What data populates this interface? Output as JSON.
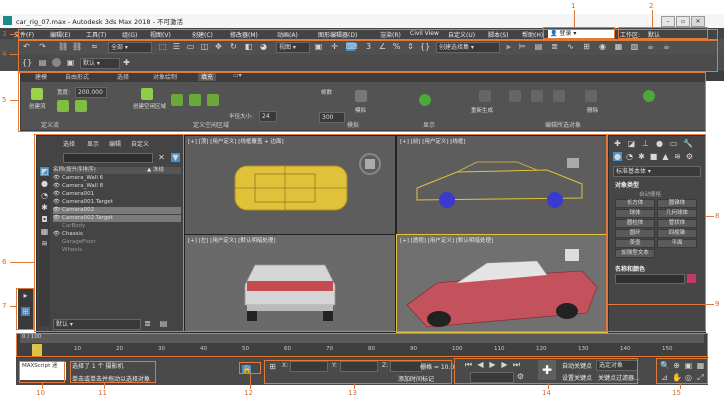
{
  "window": {
    "title": "car_rig_07.max - Autodesk 3ds Max 2018 - 不可激活",
    "min": "–",
    "max": "▫",
    "close": "✕"
  },
  "menubar": {
    "items": [
      "文件(F)",
      "编辑(E)",
      "工具(T)",
      "组(G)",
      "视图(V)",
      "创建(C)",
      "修改器(M)",
      "动画(A)",
      "图形编辑器(D)",
      "渲染(R)",
      "Civil View",
      "自定义(U)",
      "脚本(S)",
      "帮助(H)"
    ],
    "signin": "登录",
    "workspace_label": "工作区:",
    "workspace_value": "默认"
  },
  "toolbar": {
    "selection_filter": "全部",
    "view_dropdown": "视图",
    "named_selection": "创建选择集",
    "layer_combo": "默认",
    "status_combo": "默认"
  },
  "ribbon": {
    "tabs": [
      "建模",
      "自由形式",
      "选择",
      "对象绘制",
      "填充"
    ],
    "active_tab": "填充",
    "groups": {
      "define_flows": "定义流",
      "define_idle_areas": "定义空闲区域",
      "simulate": "模拟",
      "display": "显示",
      "edit_selected": "编辑所选对象"
    },
    "labels": {
      "create_flow": "创建流",
      "width": "宽度:",
      "width_value": "200.000",
      "create_idle": "创建空闲区域",
      "radius": "半径大小:",
      "radius_value": "24",
      "frames": "帧数",
      "frames_value": "300",
      "simulate_btn": "模拟",
      "regenerate": "重新生成",
      "delete": "删除"
    }
  },
  "scene_explorer": {
    "tabs": [
      "选择",
      "显示",
      "编辑",
      "自定义"
    ],
    "header": "名称(按升序排序)",
    "header2": "▲ 冻结",
    "rows": [
      "Camera_Wall 6",
      "Camera_Wall 8",
      "Camera001",
      "Camera001.Target",
      "Camera002",
      "Camera002.Target",
      "CarBody",
      "Chassis",
      "GarageFloor",
      "Wheels"
    ],
    "selected_rows": [
      4,
      5
    ],
    "layer": "默认"
  },
  "viewports": {
    "top": "[+] [顶] [用户定义] [线框覆盖 + 边面]",
    "front": "[+] [前] [用户定义] [线框]",
    "left": "[+] [左] [用户定义] [默认明暗处理]",
    "persp": "[+] [透视] [用户定义] [默认明暗处理]"
  },
  "command_panel": {
    "dropdown": "标准基本体",
    "rollout1": "对象类型",
    "autogrid": "自动栅格",
    "buttons": [
      "长方体",
      "圆锥体",
      "球体",
      "几何球体",
      "圆柱体",
      "管状体",
      "圆环",
      "四棱锥",
      "茶壶",
      "平面",
      "加强型文本"
    ],
    "rollout2": "名称和颜色",
    "color": "#c23a6a"
  },
  "timeline": {
    "frame": "0 / 100",
    "ticks": [
      "0",
      "10",
      "20",
      "30",
      "40",
      "50",
      "60",
      "70",
      "80",
      "90",
      "100",
      "110",
      "120",
      "130",
      "140",
      "150"
    ]
  },
  "statusbar": {
    "maxscript": "MAXScript 迷",
    "selected": "选择了 1 个 摄影机",
    "hint": "单击或单击并拖动以选择对象",
    "x": "X:",
    "y": "Y:",
    "z": "Z:",
    "grid": "栅格 = 10.0",
    "add_time_tag": "添加时间标记",
    "auto_key": "自动关键点",
    "set_key": "设置关键点",
    "selected_obj": "选定对象",
    "key_filters": "关键点过滤器..."
  },
  "callouts": [
    "1",
    "2",
    "3",
    "4",
    "5",
    "6",
    "7",
    "8",
    "9",
    "10",
    "11",
    "12",
    "13",
    "14",
    "15"
  ]
}
